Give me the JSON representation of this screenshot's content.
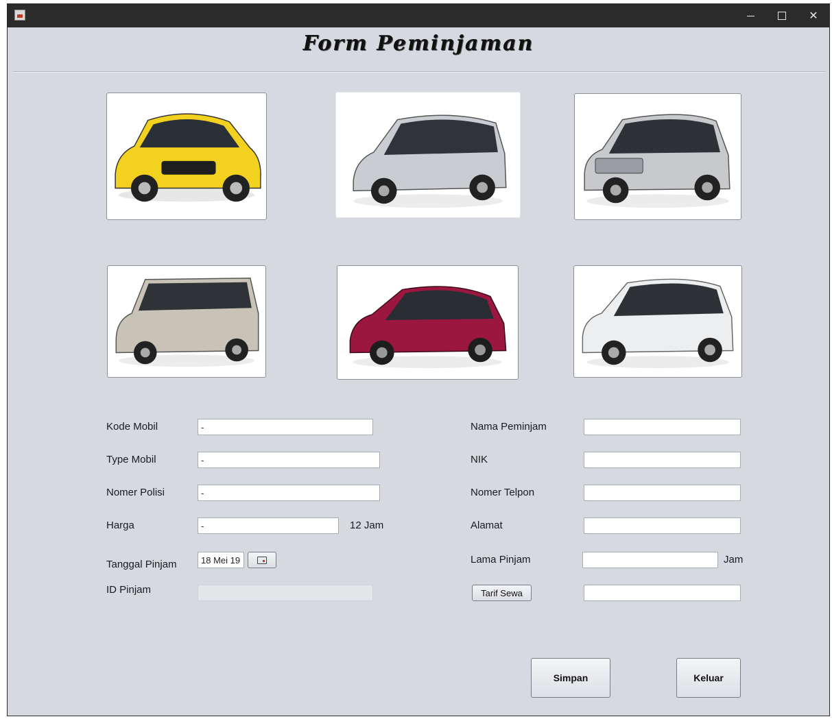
{
  "window": {
    "title": "",
    "accent": "#2b2b2b",
    "background": "#d6d9e0"
  },
  "heading": "Form Peminjaman",
  "cars": [
    {
      "name": "car-yellow-hatchback",
      "color": "#f2d21e"
    },
    {
      "name": "car-silver-minivan",
      "color": "#c9ccd0"
    },
    {
      "name": "car-silver-mpv",
      "color": "#c7c9cc"
    },
    {
      "name": "car-beige-van",
      "color": "#c8c3b6"
    },
    {
      "name": "car-red-hatchback",
      "color": "#9b1740"
    },
    {
      "name": "car-white-mpv",
      "color": "#eceef0"
    }
  ],
  "form": {
    "kode_mobil": {
      "label": "Kode Mobil",
      "value": "-"
    },
    "type_mobil": {
      "label": "Type Mobil",
      "value": "-"
    },
    "nomer_polisi": {
      "label": "Nomer Polisi",
      "value": "-"
    },
    "harga": {
      "label": "Harga",
      "value": "-",
      "suffix": "12 Jam"
    },
    "tanggal_pinjam": {
      "label": "Tanggal Pinjam",
      "value": "18 Mei 19"
    },
    "id_pinjam": {
      "label": "ID Pinjam",
      "value": ""
    },
    "nama_peminjam": {
      "label": "Nama Peminjam",
      "value": ""
    },
    "nik": {
      "label": "NIK",
      "value": ""
    },
    "nomer_telpon": {
      "label": "Nomer Telpon",
      "value": ""
    },
    "alamat": {
      "label": "Alamat",
      "value": ""
    },
    "lama_pinjam": {
      "label": "Lama Pinjam",
      "value": "",
      "suffix": "Jam"
    },
    "tarif_sewa": {
      "button_label": "Tarif Sewa",
      "value": ""
    }
  },
  "buttons": {
    "simpan": "Simpan",
    "keluar": "Keluar"
  }
}
